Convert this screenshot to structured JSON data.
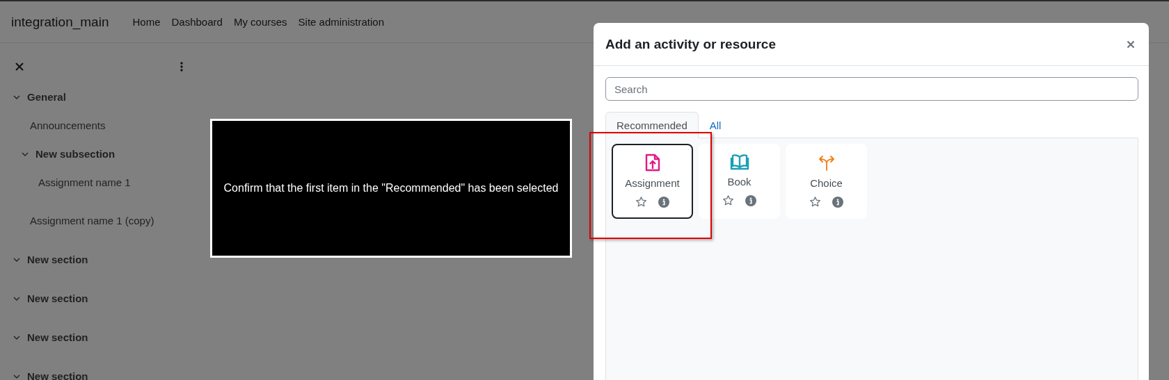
{
  "navbar": {
    "site_name": "integration_main",
    "links": [
      "Home",
      "Dashboard",
      "My courses",
      "Site administration"
    ]
  },
  "sidebar": {
    "items": [
      {
        "label": "General",
        "kind": "section",
        "expanded": true,
        "children": [
          {
            "label": "Announcements",
            "kind": "activity"
          },
          {
            "label": "New subsection",
            "kind": "section",
            "expanded": true,
            "children": [
              {
                "label": "Assignment name 1",
                "kind": "activity"
              }
            ]
          },
          {
            "label": "Assignment name 1 (copy)",
            "kind": "activity"
          }
        ]
      },
      {
        "label": "New section",
        "kind": "section",
        "expanded": true
      },
      {
        "label": "New section",
        "kind": "section",
        "expanded": true
      },
      {
        "label": "New section",
        "kind": "section",
        "expanded": true
      },
      {
        "label": "New section",
        "kind": "section",
        "expanded": true
      }
    ]
  },
  "instruction": {
    "text": "Confirm that the first item in the \"Recommended\" has been selected"
  },
  "modal": {
    "title": "Add an activity or resource",
    "search": {
      "placeholder": "Search"
    },
    "tabs": [
      {
        "label": "Recommended",
        "selected": true
      },
      {
        "label": "All",
        "selected": false
      }
    ],
    "items": [
      {
        "name": "Assignment",
        "kind": "assignment",
        "color": "#e31885",
        "selected": true
      },
      {
        "name": "Book",
        "kind": "book",
        "color": "#1a9fb5",
        "selected": false
      },
      {
        "name": "Choice",
        "kind": "choice",
        "color": "#f07d10",
        "selected": false
      }
    ]
  }
}
